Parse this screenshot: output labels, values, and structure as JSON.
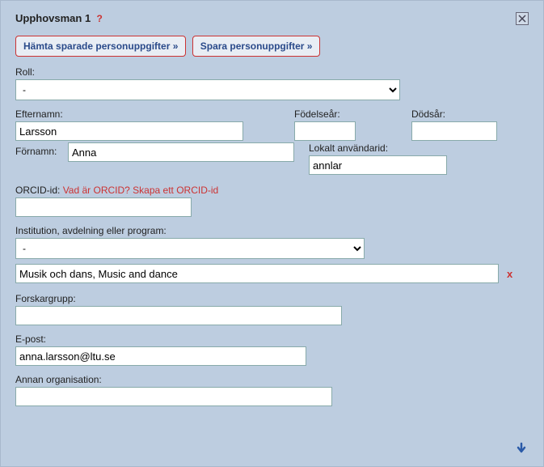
{
  "title": "Upphovsman 1",
  "help_symbol": "?",
  "buttons": {
    "fetch_saved": "Hämta sparade personuppgifter »",
    "save": "Spara personuppgifter »"
  },
  "labels": {
    "roll": "Roll:",
    "efternamn": "Efternamn:",
    "fodelseaar": "Födelseår:",
    "dodsar": "Dödsår:",
    "fornamn": "Förnamn:",
    "lokalt": "Lokalt användarid:",
    "orcid": "ORCID-id:",
    "orcid_link": "Vad är ORCID? Skapa ett ORCID-id",
    "institution": "Institution, avdelning eller program:",
    "forskargrupp": "Forskargrupp:",
    "epost": "E-post:",
    "annan": "Annan organisation:"
  },
  "values": {
    "roll": "-",
    "efternamn": "Larsson",
    "fodelseaar": "",
    "dodsar": "",
    "fornamn": "Anna",
    "lokalt": "annlar",
    "orcid": "",
    "institution": "-",
    "chosen_institution": "Musik och dans, Music and dance",
    "forskargrupp": "",
    "epost": "anna.larsson@ltu.se",
    "annan": ""
  },
  "remove_symbol": "x"
}
